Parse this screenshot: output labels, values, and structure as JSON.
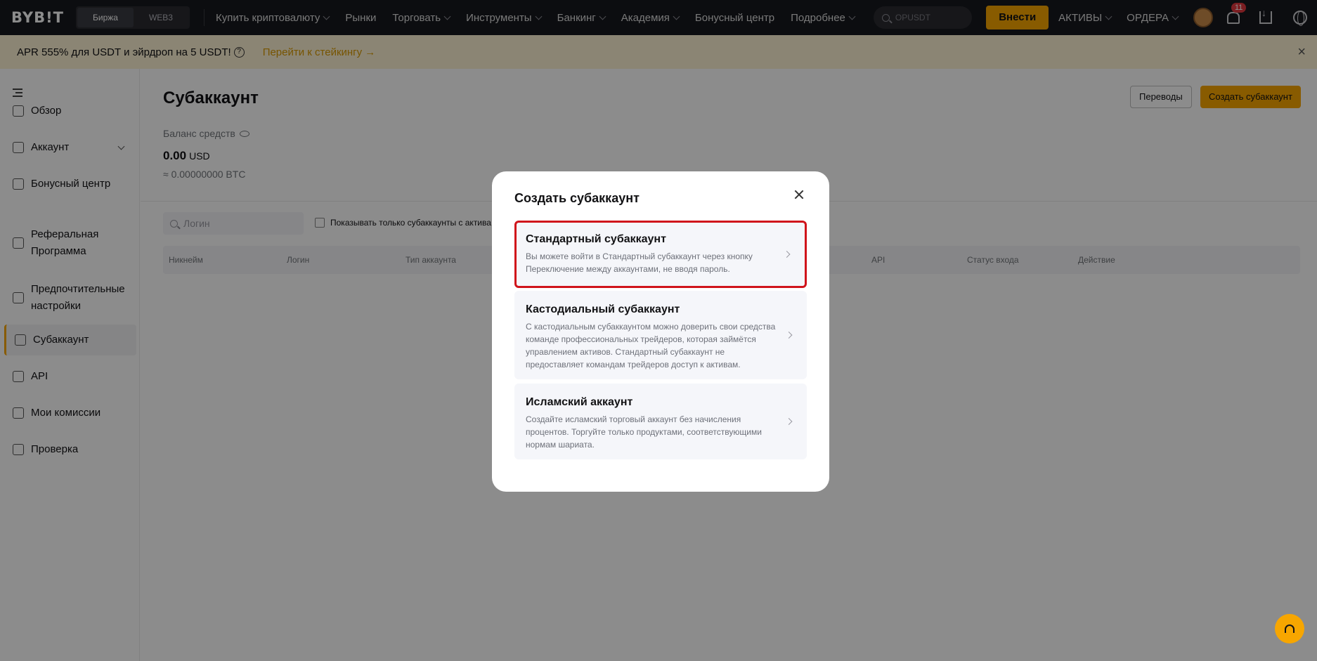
{
  "header": {
    "logo": "BYB!T",
    "segment": [
      "Биржа",
      "WEB3"
    ],
    "nav": [
      "Купить криптовалюту",
      "Рынки",
      "Торговать",
      "Инструменты",
      "Банкинг",
      "Академия",
      "Бонусный центр",
      "Подробнее"
    ],
    "search_placeholder": "OPUSDT",
    "deposit_label": "Внести",
    "assets_label": "АКТИВЫ",
    "orders_label": "ОРДЕРА",
    "notifications_count": "11"
  },
  "banner": {
    "text": "APR 555% для USDT и эйрдроп на 5 USDT!",
    "link": "Перейти к стейкингу →"
  },
  "sidebar": {
    "items": [
      {
        "label": "Обзор"
      },
      {
        "label": "Аккаунт"
      },
      {
        "label": "Бонусный центр"
      },
      {
        "label": "Реферальная Программа"
      },
      {
        "label": "Предпочтительные настройки"
      },
      {
        "label": "Субаккаунт"
      },
      {
        "label": "API"
      },
      {
        "label": "Мои комиссии"
      },
      {
        "label": "Проверка"
      }
    ]
  },
  "main": {
    "title": "Субаккаунт",
    "transfers_label": "Переводы",
    "create_label": "Создать субаккаунт",
    "balance_label": "Баланс средств",
    "balance_value": "0.00",
    "balance_currency": "USD",
    "balance_btc": "≈ 0.00000000 BTC",
    "filter_placeholder": "Логин",
    "checkbox_label": "Показывать только субаккаунты с актива",
    "columns": [
      "Никнейм",
      "Логин",
      "Тип аккаунта",
      "API",
      "Статус входа",
      "Действие"
    ]
  },
  "modal": {
    "title": "Создать субаккаунт",
    "options": [
      {
        "title": "Стандартный субаккаунт",
        "desc": "Вы можете войти в Стандартный субаккаунт через кнопку Переключение между аккаунтами, не вводя пароль."
      },
      {
        "title": "Кастодиальный субаккаунт",
        "desc": "С кастодиальным субаккаунтом можно доверить свои средства команде профессиональных трейдеров, которая займётся управлением активов. Стандартный субаккаунт не предоставляет командам трейдеров доступ к активам."
      },
      {
        "title": "Исламский аккаунт",
        "desc": "Создайте исламский торговый аккаунт без начисления процентов. Торгуйте только продуктами, соответствующими нормам шариата."
      }
    ]
  },
  "colors": {
    "accent": "#f7a600",
    "highlight": "#d0141b",
    "topbar": "#17181e"
  }
}
